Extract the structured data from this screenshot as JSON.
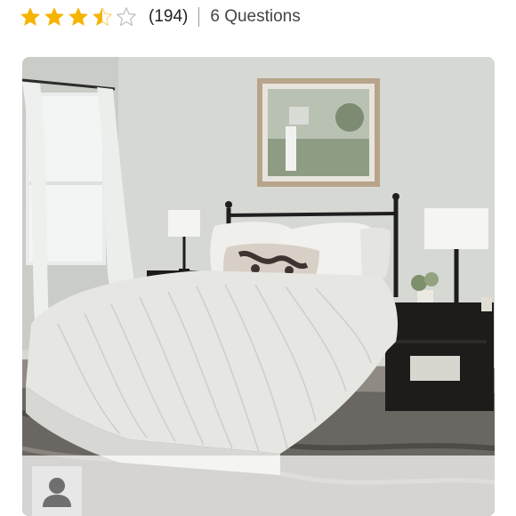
{
  "rating": {
    "value": 3.5,
    "max": 5,
    "count_label": "(194)",
    "questions_label": "6 Questions",
    "star_color": "#f5b400",
    "empty_star_color": "#bdbdbd"
  },
  "photo": {
    "subject": "bedroom with bed, lamps and nightstands"
  },
  "reviewer": {
    "avatar_icon": "user-silhouette-icon"
  }
}
